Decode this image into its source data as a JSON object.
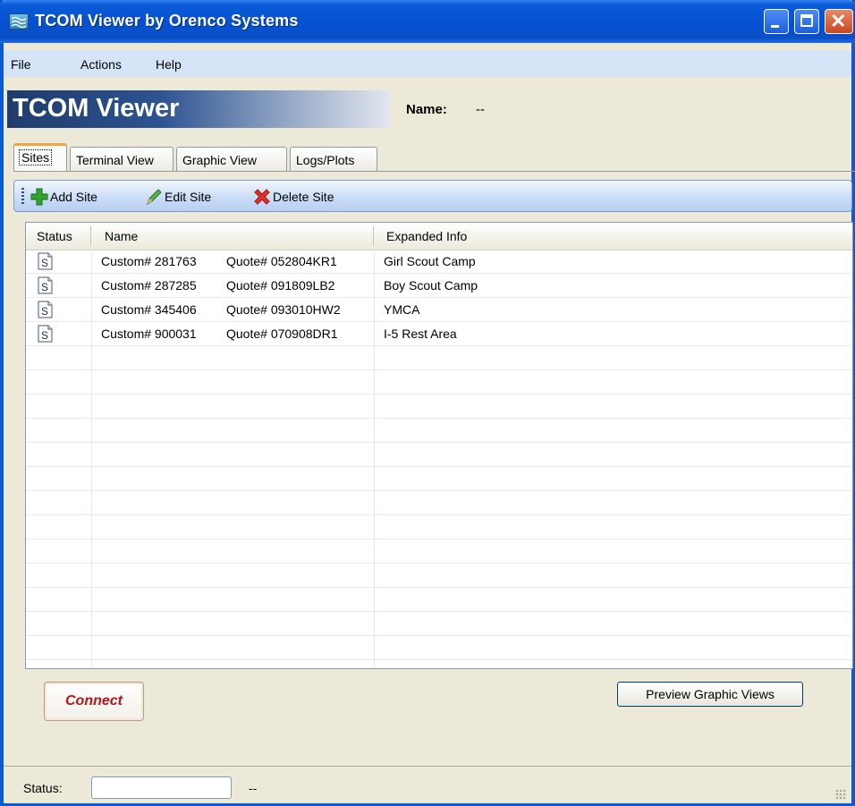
{
  "window": {
    "title": "TCOM Viewer by Orenco Systems",
    "title_bar_color": "#0a5ad6",
    "controls": [
      "minimize-icon",
      "maximize-icon",
      "close-icon"
    ]
  },
  "menu": {
    "items": [
      {
        "label": "File"
      },
      {
        "label": "Actions"
      },
      {
        "label": "Help"
      }
    ]
  },
  "header": {
    "banner": "TCOM Viewer",
    "name_label": "Name:",
    "name_value": "--"
  },
  "tabs": [
    {
      "label": "Sites",
      "active": true
    },
    {
      "label": "Terminal View",
      "active": false
    },
    {
      "label": "Graphic View",
      "active": false
    },
    {
      "label": "Logs/Plots",
      "active": false
    }
  ],
  "toolbar": {
    "add": {
      "label": "Add Site",
      "icon": "plus-icon"
    },
    "edit": {
      "label": "Edit Site",
      "icon": "pencil-icon"
    },
    "delete": {
      "label": "Delete Site",
      "icon": "red-x-icon"
    }
  },
  "grid": {
    "columns": [
      "Status",
      "Name",
      "Expanded Info"
    ],
    "rows": [
      {
        "status_icon": "document-s-icon",
        "custom": "Custom# 281763",
        "quote": "Quote# 052804KR1",
        "info": "Girl Scout Camp"
      },
      {
        "status_icon": "document-s-icon",
        "custom": "Custom# 287285",
        "quote": "Quote# 091809LB2",
        "info": "Boy Scout Camp"
      },
      {
        "status_icon": "document-s-icon",
        "custom": "Custom# 345406",
        "quote": "Quote# 093010HW2",
        "info": "YMCA"
      },
      {
        "status_icon": "document-s-icon",
        "custom": "Custom# 900031",
        "quote": "Quote# 070908DR1",
        "info": "I-5 Rest Area"
      }
    ]
  },
  "buttons": {
    "connect": "Connect",
    "connect_color": "#b5151b",
    "preview": "Preview Graphic Views"
  },
  "statusbar": {
    "label": "Status:",
    "field_value": "",
    "value": "--"
  }
}
